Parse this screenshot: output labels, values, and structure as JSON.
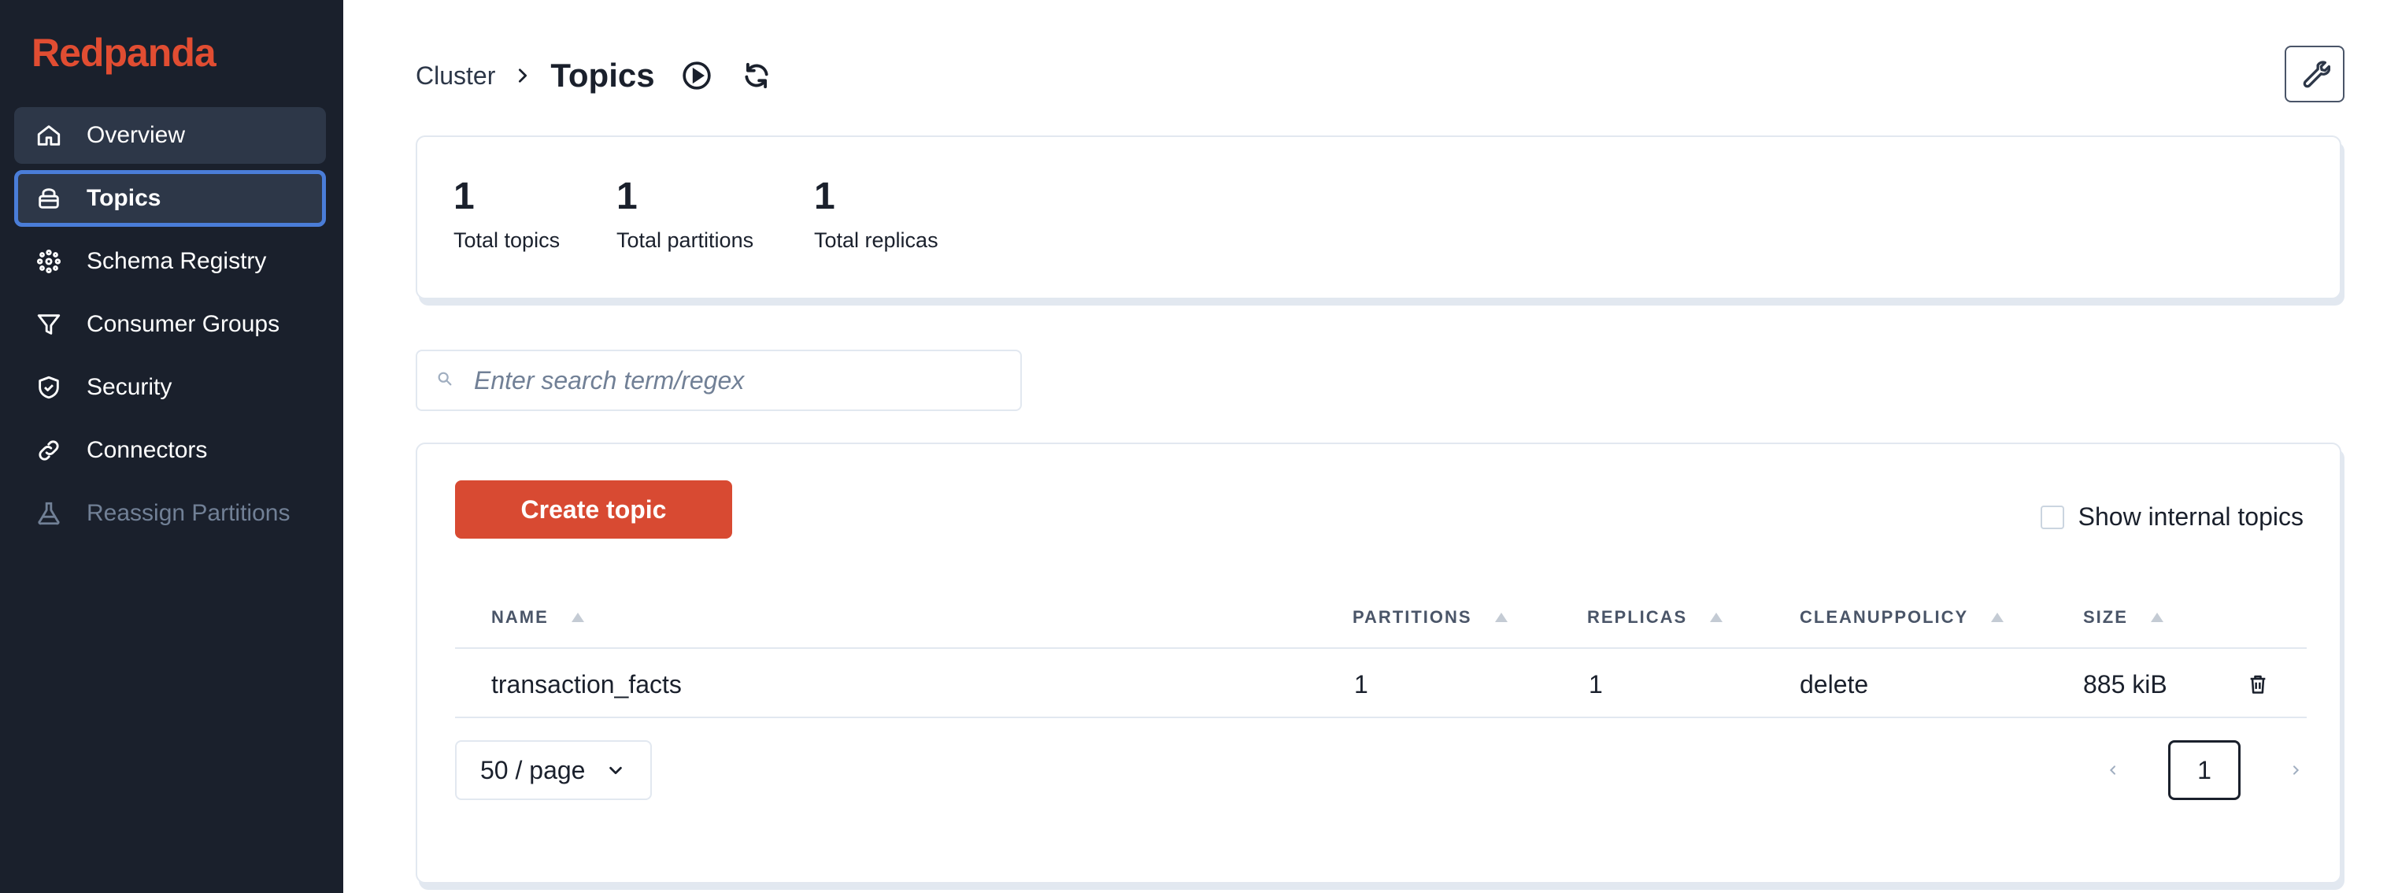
{
  "app": {
    "logo": "Redpanda",
    "brand_color": "#e14d32"
  },
  "sidebar": {
    "items": [
      {
        "label": "Overview",
        "icon": "home-icon",
        "state": "hover"
      },
      {
        "label": "Topics",
        "icon": "topics-icon",
        "state": "active"
      },
      {
        "label": "Schema Registry",
        "icon": "schema-icon",
        "state": "normal"
      },
      {
        "label": "Consumer Groups",
        "icon": "filter-icon",
        "state": "normal"
      },
      {
        "label": "Security",
        "icon": "shield-icon",
        "state": "normal"
      },
      {
        "label": "Connectors",
        "icon": "link-icon",
        "state": "normal"
      },
      {
        "label": "Reassign Partitions",
        "icon": "flask-icon",
        "state": "disabled"
      }
    ]
  },
  "header": {
    "breadcrumb_parent": "Cluster",
    "title": "Topics"
  },
  "stats": [
    {
      "value": "1",
      "label": "Total topics"
    },
    {
      "value": "1",
      "label": "Total partitions"
    },
    {
      "value": "1",
      "label": "Total replicas"
    }
  ],
  "search": {
    "placeholder": "Enter search term/regex",
    "value": ""
  },
  "actions": {
    "create_topic": "Create topic",
    "show_internal": "Show internal topics",
    "show_internal_checked": false
  },
  "table": {
    "columns": [
      "NAME",
      "PARTITIONS",
      "REPLICAS",
      "CLEANUPPOLICY",
      "SIZE"
    ],
    "rows": [
      {
        "name": "transaction_facts",
        "partitions": "1",
        "replicas": "1",
        "cleanup": "delete",
        "size": "885 kiB"
      }
    ]
  },
  "pagination": {
    "page_size": "50 / page",
    "current_page": "1"
  }
}
